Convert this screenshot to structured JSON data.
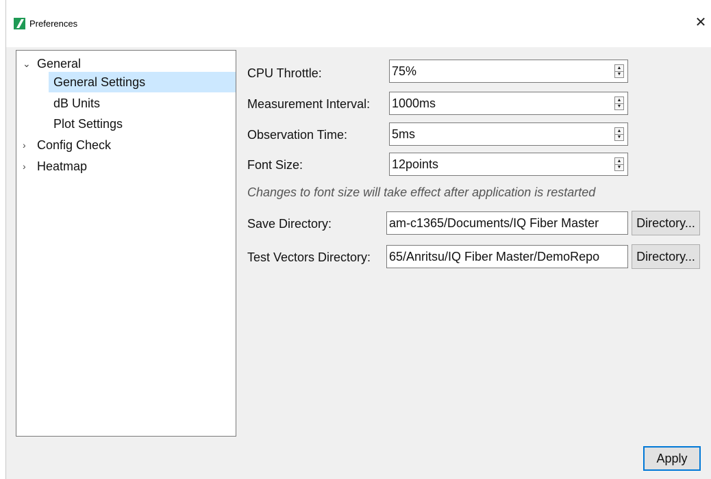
{
  "window": {
    "title": "Preferences",
    "close_glyph": "✕",
    "icon": "anritsu-logo-icon"
  },
  "tree": {
    "items": [
      {
        "label": "General",
        "expanded": true,
        "level": 0,
        "arrow": "⌄"
      },
      {
        "label": "General Settings",
        "level": 1,
        "selected": true
      },
      {
        "label": "dB Units",
        "level": 1
      },
      {
        "label": "Plot Settings",
        "level": 1
      },
      {
        "label": "Config Check",
        "expanded": false,
        "level": 0,
        "arrow": "›"
      },
      {
        "label": "Heatmap",
        "expanded": false,
        "level": 0,
        "arrow": "›"
      }
    ]
  },
  "form": {
    "cpu_throttle": {
      "label": "CPU Throttle:",
      "value": "75%"
    },
    "measurement_interval": {
      "label": "Measurement Interval:",
      "value": "1000ms"
    },
    "observation_time": {
      "label": "Observation Time:",
      "value": "5ms"
    },
    "font_size": {
      "label": "Font Size:",
      "value": "12points"
    },
    "font_note": "Changes to font size will take effect after application is restarted",
    "save_directory": {
      "label": "Save Directory:",
      "value": "am-c1365/Documents/IQ Fiber Master",
      "button": "Directory..."
    },
    "test_vectors_directory": {
      "label": "Test Vectors Directory:",
      "value": "65/Anritsu/IQ Fiber Master/DemoRepo",
      "button": "Directory..."
    }
  },
  "actions": {
    "apply_label": "Apply"
  },
  "colors": {
    "selection": "#cce8ff",
    "accent": "#0078d7",
    "logo": "#1f9a55"
  }
}
